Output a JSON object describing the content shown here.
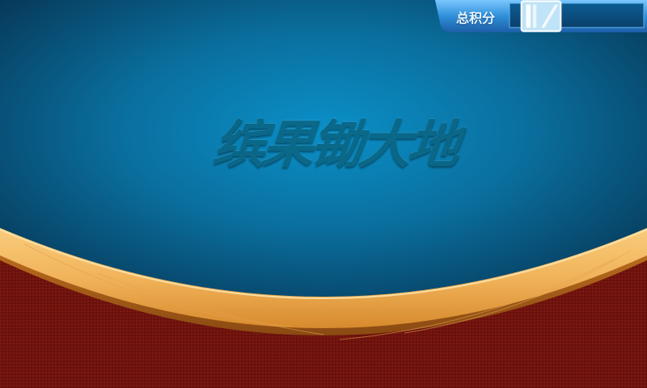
{
  "game": {
    "title": "缤果锄大地"
  },
  "score_panel": {
    "label": "总积分",
    "icon": "glass-card-icon",
    "value": ""
  },
  "colors": {
    "felt_center": "#0a8cc2",
    "felt_edge": "#07324f",
    "wood_light": "#f6c06a",
    "wood_dark": "#d98a2c",
    "table_red": "#7a1410",
    "panel_blue": "#2f8fd8"
  }
}
